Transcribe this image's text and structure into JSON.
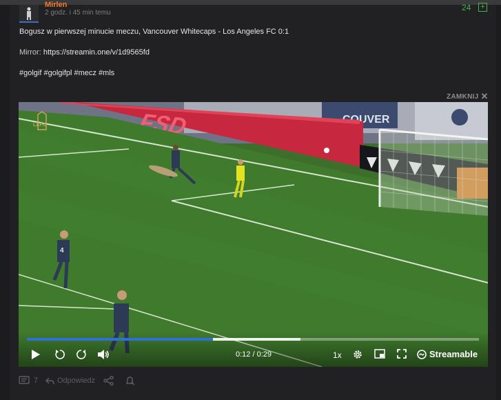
{
  "post": {
    "author": "Mirlen",
    "meta": "2 godz. i 45 min temu",
    "score": "24",
    "plus_label": "+",
    "line1": "Bogusz w pierwszej minucie meczu, Vancouver Whitecaps - Los Angeles FC 0:1",
    "mirror_label": "Mirror:",
    "mirror_url": "https://streamin.one/v/1d9565fd",
    "tags": "#golgif #golgifpl #mecz #mls",
    "close_label": "ZAMKNIJ",
    "close_glyph": "✕"
  },
  "video": {
    "time": "0:12 / 0:29",
    "progress_played": 0.412,
    "progress_buffered": 0.605,
    "speed": "1x",
    "brand": "Streamable",
    "board_text": "FSD",
    "stand_text": "COUVER",
    "overlay_logo": "LAFC",
    "player_number": "4"
  },
  "footer": {
    "comments_count": "7",
    "reply_label": "Odpowiedz"
  },
  "colors": {
    "accent_orange": "#f07b2a",
    "vote_green": "#41b54a",
    "progress_blue": "#2f6fd6"
  }
}
